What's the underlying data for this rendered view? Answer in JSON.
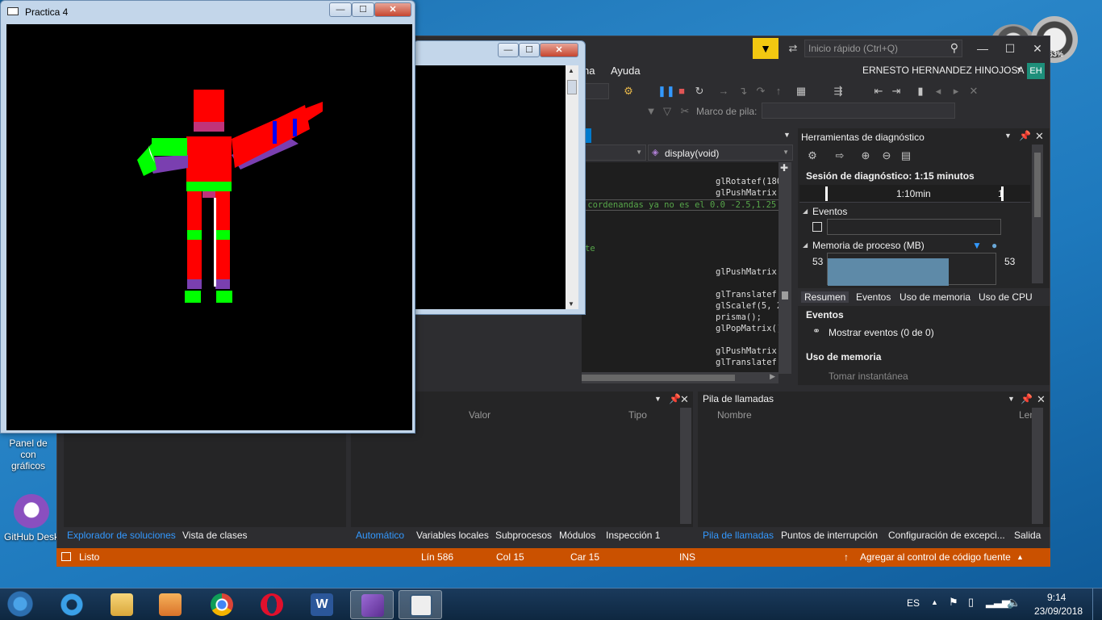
{
  "desktop": {
    "icons": [
      {
        "label_line1": "Panel de con",
        "label_line2": "gráficos"
      },
      {
        "label_line1": "GitHub Desk",
        "label_line2": ""
      }
    ]
  },
  "gauge_widget": {
    "percent": "63%"
  },
  "practica_window": {
    "title": "Practica 4",
    "minimize": "—",
    "maximize": "☐",
    "close": "✕"
  },
  "console_window": {
    "minimize": "—",
    "maximize": "☐",
    "close": "✕"
  },
  "vs": {
    "quick_launch_placeholder": "Inicio rápido (Ctrl+Q)",
    "user_name": "ERNESTO HERNANDEZ HINOJOSA",
    "user_initials": "EH",
    "menu": {
      "partial": "na",
      "help": "Ayuda"
    },
    "stack_frame_label": "Marco de pila:",
    "editor": {
      "function_dropdown": "display(void)",
      "code_lines": [
        "glRotatef(180",
        "glPushMatrix(",
        "",
        "",
        "",
        "",
        "",
        "",
        "glPushMatrix(",
        "",
        "glTranslatef(",
        "glScalef(5, 2",
        "prisma();",
        "glPopMatrix()",
        "",
        "glPushMatrix(",
        "glTranslatef("
      ],
      "comment_line": " cordenandas ya no es el 0.0 -2.5,1.25",
      "comment_fragment": "te"
    },
    "diagnostics": {
      "title": "Herramientas de diagnóstico",
      "session": "Sesión de diagnóstico: 1:15 minutos",
      "timeline_label": "1:10min",
      "timeline_end": "1",
      "events_section": "Eventos",
      "memory_section": "Memoria de proceso (MB)",
      "memory_left": "53",
      "memory_right": "53",
      "tabs": [
        "Resumen",
        "Eventos",
        "Uso de memoria",
        "Uso de CPU"
      ],
      "summary_events": "Eventos",
      "show_events": "Mostrar eventos (0 de 0)",
      "memory_usage": "Uso de memoria",
      "take_snapshot": "Tomar instantánea"
    },
    "locals_panel": {
      "col_value": "Valor",
      "col_type": "Tipo",
      "tabs": [
        "Automático",
        "Variables locales",
        "Subprocesos",
        "Módulos",
        "Inspección 1"
      ]
    },
    "callstack_panel": {
      "title": "Pila de llamadas",
      "col_name": "Nombre",
      "col_lang": "Leng",
      "tabs": [
        "Pila de llamadas",
        "Puntos de interrupción",
        "Configuración de excepci...",
        "Salida"
      ]
    },
    "solution_panel": {
      "tabs": [
        "Explorador de soluciones",
        "Vista de clases"
      ]
    },
    "status": {
      "ready": "Listo",
      "line": "Lín 586",
      "col": "Col 15",
      "char": "Car 15",
      "ins": "INS",
      "source_control": "Agregar al control de código fuente"
    }
  },
  "taskbar": {
    "language": "ES",
    "time": "9:14",
    "date": "23/09/2018",
    "apps": [
      "start-button",
      "internet-explorer",
      "file-explorer",
      "media-player",
      "chrome",
      "opera",
      "word",
      "visual-studio",
      "opengl-app"
    ]
  },
  "colors": {
    "vs_background": "#2d2d30",
    "status_bar": "#ca5100",
    "accent_blue": "#3399ff",
    "robot_red": "#ff0000",
    "robot_green": "#00ff00",
    "robot_purple": "#7a3fb0"
  }
}
